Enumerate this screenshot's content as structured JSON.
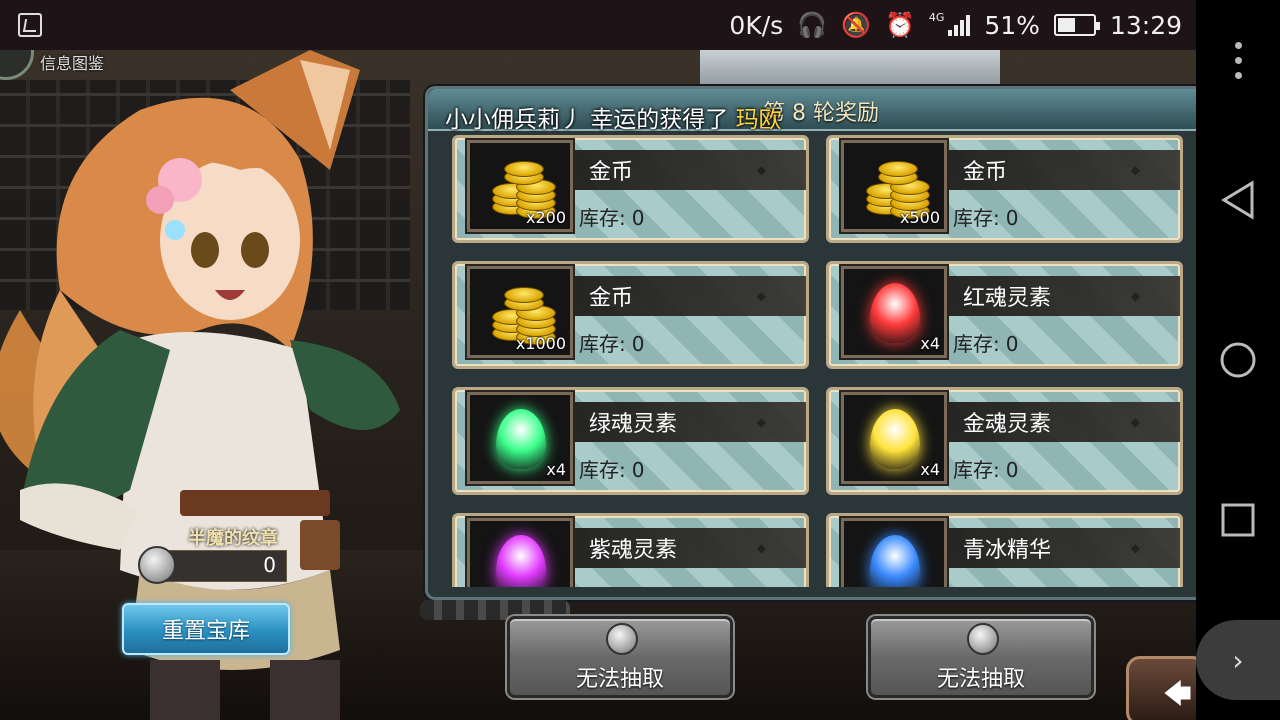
{
  "statusbar": {
    "net_speed": "0K/s",
    "network_type": "4G",
    "battery_percent": "51%",
    "battery_level": 0.51,
    "time": "13:29",
    "icons": [
      "gallery-icon",
      "headphones-icon",
      "mute-icon",
      "alarm-icon",
      "signal-icon",
      "battery-icon"
    ]
  },
  "game": {
    "info_tab": "信息图鉴",
    "announcement": {
      "prefix": "小小佣兵莉丿 幸运的获得了",
      "item": "玛欧"
    },
    "rewards_panel": {
      "title": "第 8 轮奖励",
      "stock_label": "库存:",
      "items": [
        {
          "name": "金币",
          "qty": "x200",
          "stock": "0",
          "icon": "gold-coins-icon"
        },
        {
          "name": "金币",
          "qty": "x500",
          "stock": "0",
          "icon": "gold-coins-icon"
        },
        {
          "name": "金币",
          "qty": "x1000",
          "stock": "0",
          "icon": "gold-coins-icon"
        },
        {
          "name": "红魂灵素",
          "qty": "x4",
          "stock": "0",
          "icon": "red-soul-crystal-icon",
          "color": "#ff3a3a"
        },
        {
          "name": "绿魂灵素",
          "qty": "x4",
          "stock": "0",
          "icon": "green-soul-crystal-icon",
          "color": "#3aff8a"
        },
        {
          "name": "金魂灵素",
          "qty": "x4",
          "stock": "0",
          "icon": "gold-soul-crystal-icon",
          "color": "#ffe23a"
        },
        {
          "name": "紫魂灵素",
          "qty": "",
          "stock": "",
          "icon": "purple-soul-crystal-icon",
          "color": "#e23aff"
        },
        {
          "name": "青冰精华",
          "qty": "",
          "stock": "",
          "icon": "blue-ice-essence-icon",
          "color": "#3a8aff"
        }
      ]
    },
    "emblem": {
      "title": "半魔的纹章",
      "count": "0"
    },
    "reset_button": "重置宝库",
    "draw_buttons": [
      "无法抽取",
      "无法抽取"
    ],
    "colors": {
      "reset_button": "#2a8fc0",
      "announcement_highlight": "#ffd23c"
    }
  }
}
